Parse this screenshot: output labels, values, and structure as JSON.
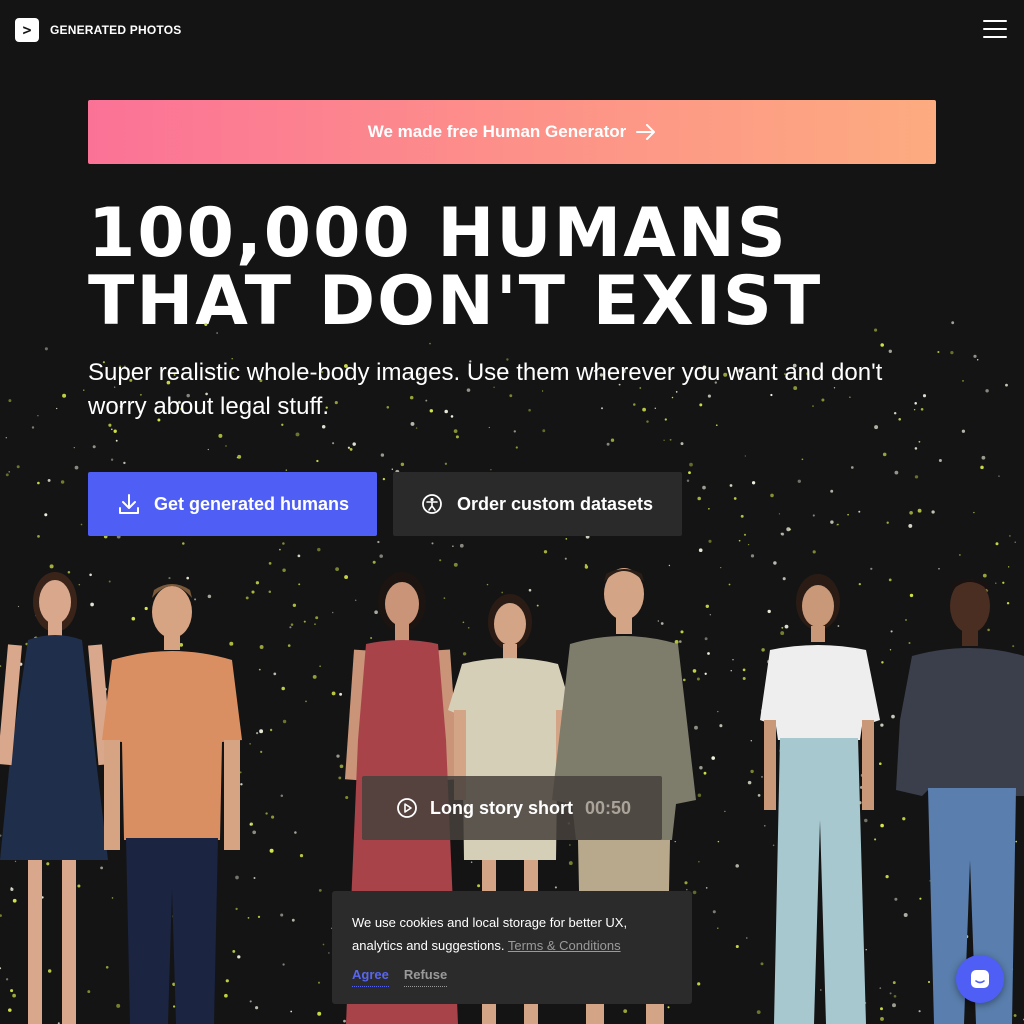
{
  "header": {
    "logo_glyph": ">",
    "logo_text": "GENERATED PHOTOS",
    "menu_icon": "hamburger-menu-icon"
  },
  "promo": {
    "label": "We made free Human Generator",
    "icon": "arrow-right-icon",
    "gradient": [
      "#fb7297",
      "#fdab80"
    ]
  },
  "hero": {
    "title_line1": "100,000 humans",
    "title_line2": "that don't exist",
    "subtitle": "Super realistic whole-body images. Use them wherever you want and don't worry about legal stuff."
  },
  "cta": {
    "primary_label": "Get generated humans",
    "primary_icon": "download-icon",
    "secondary_label": "Order custom datasets",
    "secondary_icon": "custom-dataset-icon",
    "accent": "#4f5ff5"
  },
  "video": {
    "label": "Long story short",
    "duration": "00:50",
    "icon": "play-icon"
  },
  "cookie": {
    "text": "We use cookies and local storage for better UX, analytics and suggestions.",
    "terms_label": "Terms & Conditions",
    "agree_label": "Agree",
    "refuse_label": "Refuse"
  },
  "chat": {
    "icon": "chat-icon"
  }
}
